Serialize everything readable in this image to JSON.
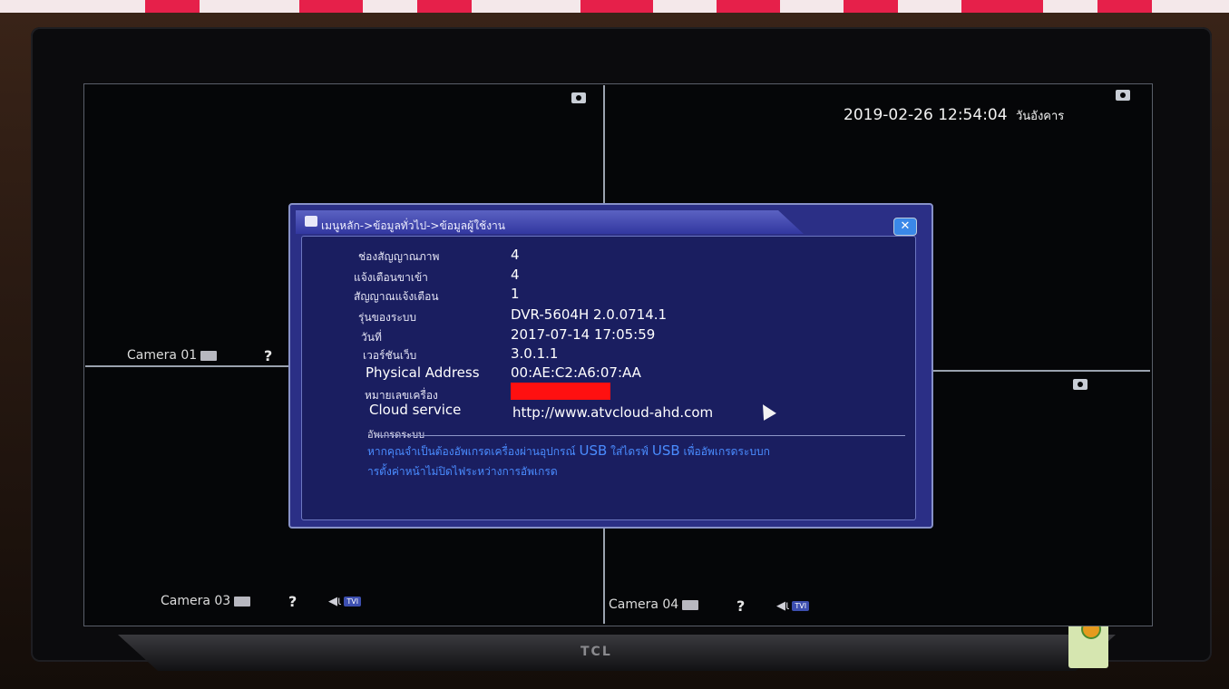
{
  "screen": {
    "datetime": "2019-02-26 12:54:04",
    "weekday": "วันอังคาร"
  },
  "tv_brand": "TCL",
  "cameras": [
    {
      "label": "Camera 01"
    },
    {
      "label": "Camera 03"
    },
    {
      "label": "Camera 04"
    }
  ],
  "tvi_tag": "TVI",
  "help_glyph": "?",
  "dialog": {
    "breadcrumb": "เมนูหลัก->ข้อมูลทั่วไป->ข้อมูลผู้ใช้งาน",
    "close_glyph": "✕",
    "rows": [
      {
        "label": "ช่องสัญญาณภาพ",
        "value": "4"
      },
      {
        "label": "แจ้งเตือนขาเข้า",
        "value": "4"
      },
      {
        "label": "สัญญาณแจ้งเตือน",
        "value": "1"
      },
      {
        "label": "รุ่นของระบบ",
        "value": "DVR-5604H  2.0.0714.1"
      },
      {
        "label": "วันที่",
        "value": "2017-07-14 17:05:59"
      },
      {
        "label": "เวอร์ชันเว็บ",
        "value": "3.0.1.1"
      },
      {
        "label": "Physical Address",
        "value": "00:AE:C2:A6:07:AA"
      },
      {
        "label": "หมายเลขเครื่อง",
        "value": ""
      },
      {
        "label": "Cloud service",
        "value": "http://www.atvcloud-ahd.com"
      }
    ],
    "section_title": "อัพเกรดระบบ",
    "upgrade_text_1a": "หากคุณจำเป็นต้องอัพเกรดเครื่องผ่านอุปกรณ์",
    "upgrade_usb_1": "USB",
    "upgrade_text_1b": "ใส่ไดรฟ์",
    "upgrade_usb_2": "USB",
    "upgrade_text_1c": "เพื่ออัพเกรดระบบก",
    "upgrade_text_2": "ารตั้งค่าหน้าไม่ปิดไฟระหว่างการอัพเกรด"
  },
  "colors": {
    "dialog_bg": "#1a1e60",
    "redaction": "#ff1010",
    "upgrade_text": "#4a8cff"
  }
}
